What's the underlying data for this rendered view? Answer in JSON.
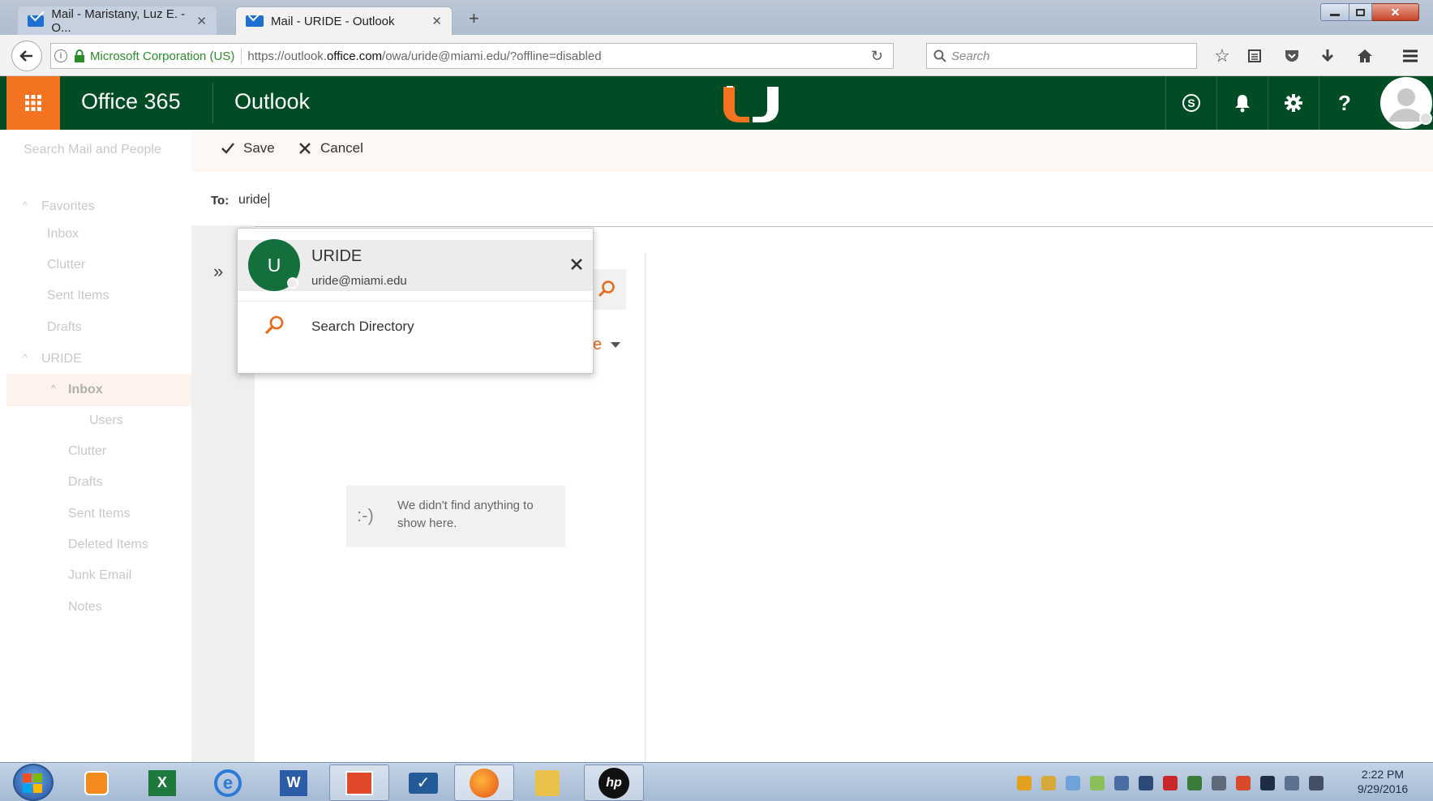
{
  "browser": {
    "tabs": [
      {
        "title": "Mail - Maristany, Luz E. - O...",
        "active": false
      },
      {
        "title": "Mail - URIDE - Outlook",
        "active": true
      }
    ],
    "new_tab_glyph": "+",
    "identity": "Microsoft Corporation (US)",
    "url_prefix": "https://outlook.",
    "url_domain": "office.com",
    "url_path": "/owa/uride@miami.edu/?offline=disabled",
    "search_placeholder": "Search"
  },
  "header": {
    "suite_title": "Office 365",
    "app_title": "Outlook",
    "brand_color": "#004c24",
    "accent_color": "#f47321"
  },
  "left_nav": {
    "search_placeholder": "Search Mail and People",
    "favorites_label": "Favorites",
    "favorites": [
      "Inbox",
      "Clutter",
      "Sent Items",
      "Drafts"
    ],
    "account_label": "URIDE",
    "inbox_label": "Inbox",
    "inbox_children": [
      "Users"
    ],
    "folders": [
      "Clutter",
      "Drafts",
      "Sent Items",
      "Deleted Items",
      "Junk Email",
      "Notes"
    ]
  },
  "command_bar": {
    "save_label": "Save",
    "cancel_label": "Cancel"
  },
  "compose": {
    "to_label": "To:",
    "to_value": "uride"
  },
  "suggestion": {
    "avatar_letter": "U",
    "name": "URIDE",
    "email": "uride@miami.edu",
    "search_directory_label": "Search Directory"
  },
  "partial_hidden_text": "e",
  "empty_state": {
    "emoticon": ":-)",
    "message": "We didn't find anything to show here."
  },
  "taskbar": {
    "time": "2:22 PM",
    "date": "9/29/2016"
  }
}
